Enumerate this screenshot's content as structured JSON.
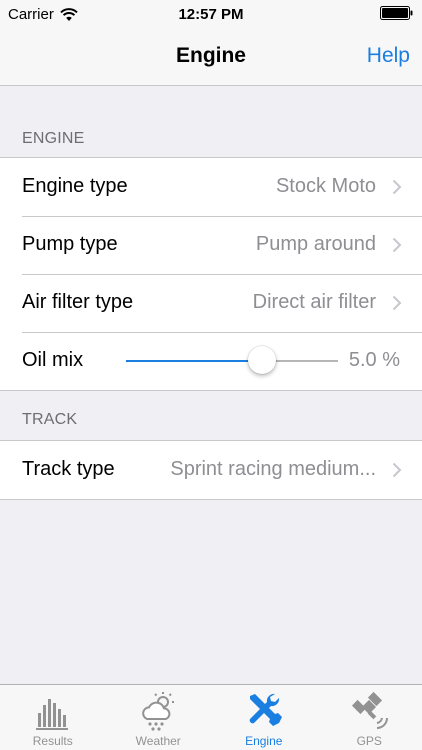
{
  "status_bar": {
    "carrier": "Carrier",
    "time": "12:57 PM"
  },
  "nav": {
    "title": "Engine",
    "help_label": "Help"
  },
  "sections": {
    "engine": {
      "header": "ENGINE",
      "rows": [
        {
          "label": "Engine type",
          "value": "Stock Moto"
        },
        {
          "label": "Pump type",
          "value": "Pump around"
        },
        {
          "label": "Air filter type",
          "value": "Direct air filter"
        }
      ],
      "oil_mix": {
        "label": "Oil mix",
        "value_text": "5.0 %",
        "slider_fraction": 0.64
      }
    },
    "track": {
      "header": "TRACK",
      "rows": [
        {
          "label": "Track type",
          "value": "Sprint racing medium..."
        }
      ]
    }
  },
  "tabs": [
    {
      "label": "Results",
      "icon": "bar-chart-icon"
    },
    {
      "label": "Weather",
      "icon": "cloud-sun-rain-icon"
    },
    {
      "label": "Engine",
      "icon": "wrench-screwdriver-icon",
      "active": true
    },
    {
      "label": "GPS",
      "icon": "satellite-icon"
    }
  ],
  "colors": {
    "accent": "#1a7fe0",
    "inactive": "#929292",
    "background": "#efeff4"
  }
}
